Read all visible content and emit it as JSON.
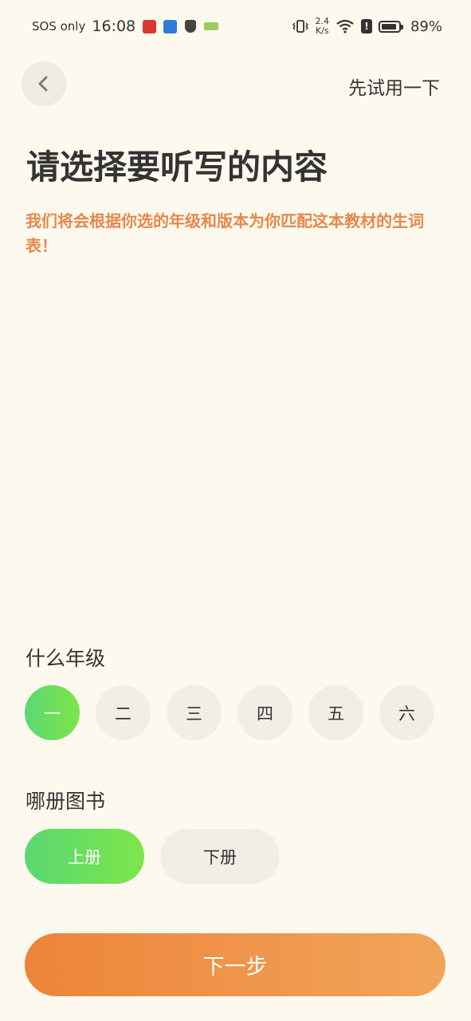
{
  "status_bar": {
    "carrier": "SOS only",
    "time": "16:08",
    "net_speed_value": "2.4",
    "net_speed_unit": "K/s",
    "battery": "89%",
    "battery_level": 0.89,
    "icons": [
      "app-red-icon",
      "app-blue-icon",
      "shield-icon",
      "app-green-icon",
      "vibrate-icon",
      "wifi-icon",
      "alert-icon",
      "battery-icon"
    ]
  },
  "header": {
    "back_icon": "chevron-left-icon",
    "try_label": "先试用一下"
  },
  "title": "请选择要听写的内容",
  "subtitle": "我们将会根据你选的年级和版本为你匹配这本教材的生词表！",
  "grade": {
    "label": "什么年级",
    "options": [
      "一",
      "二",
      "三",
      "四",
      "五",
      "六"
    ],
    "selected_index": 0
  },
  "volume": {
    "label": "哪册图书",
    "options": [
      "上册",
      "下册"
    ],
    "selected_index": 0
  },
  "next_label": "下一步",
  "colors": {
    "background": "#FDF9EE",
    "accent_orange": "#E8874A",
    "accent_green": "#6ADF5C",
    "chip_bg": "#F1EFE5"
  }
}
